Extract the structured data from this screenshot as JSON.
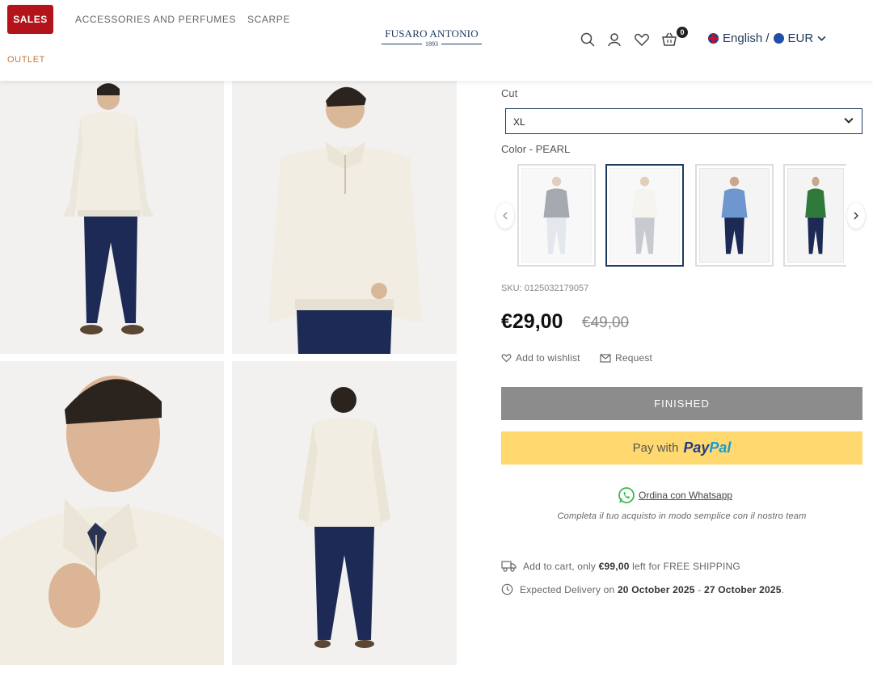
{
  "header": {
    "sales_label": "SALES",
    "nav": [
      "ACCESSORIES AND PERFUMES",
      "SCARPE",
      "OUTLET"
    ],
    "logo_name": "FUSARO ANTONIO",
    "logo_year": "1893",
    "cart_count": "0",
    "language": "English /",
    "currency": "EUR"
  },
  "product": {
    "cut_label": "Cut",
    "cut_value": "XL",
    "color_label": "Color - PEARL",
    "swatches": [
      "grey",
      "pearl",
      "light-blue",
      "green"
    ],
    "sku": "SKU: 0125032179057",
    "price": "€29,00",
    "old_price": "€49,00",
    "wishlist_label": "Add to wishlist",
    "request_label": "Request",
    "finished_label": "FINISHED",
    "paypal_prefix": "Pay with",
    "paypal_brand_a": "Pay",
    "paypal_brand_b": "Pal",
    "whatsapp_label": "Ordina con Whatsapp",
    "whatsapp_sub": "Completa il tuo acquisto in modo semplice con il nostro team",
    "shipping_pre": "Add to cart, only",
    "shipping_amount": "€99,00",
    "shipping_post": "left for FREE SHIPPING",
    "delivery_pre": "Expected Delivery on",
    "delivery_from": "20 October 2025",
    "delivery_sep": "-",
    "delivery_to": "27 October 2025",
    "delivery_end": "."
  },
  "colors": {
    "brand_navy": "#1f3a5f",
    "sales_red": "#b3141b",
    "outlet_orange": "#c0793a",
    "finished_grey": "#8c8c8c",
    "paypal_yellow": "#ffd970"
  }
}
